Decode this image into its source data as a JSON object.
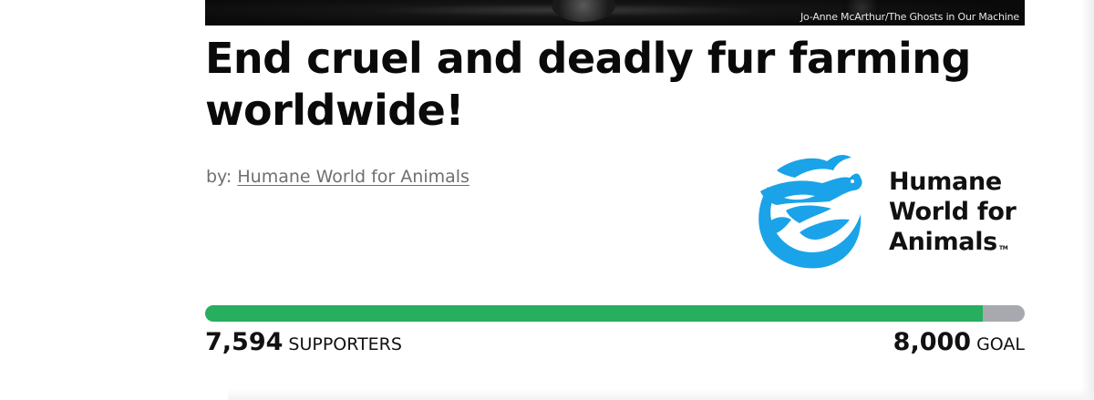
{
  "hero": {
    "photo_credit": "Jo-Anne McArthur/The Ghosts in Our Machine"
  },
  "petition": {
    "title": "End cruel and deadly fur farming worldwide!",
    "byline_prefix": "by:",
    "organization": "Humane World for Animals"
  },
  "logo": {
    "line1": "Humane",
    "line2": "World for",
    "line3": "Animals",
    "trademark": "TM",
    "brand_color": "#1aa3e8",
    "icon": "animals-globe-logo"
  },
  "progress": {
    "supporters": "7,594",
    "supporters_label": "SUPPORTERS",
    "goal": "8,000",
    "goal_label": "GOAL",
    "fraction": 0.949,
    "fill_color": "#27ae5f",
    "track_color": "#a7a9ae"
  }
}
